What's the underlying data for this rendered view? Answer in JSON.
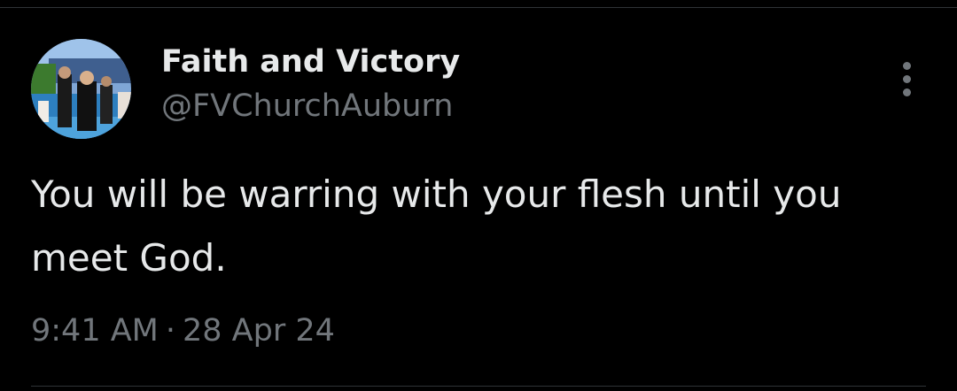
{
  "tweet": {
    "author": {
      "display_name": "Faith and Victory",
      "handle": "@FVChurchAuburn",
      "avatar_icon": "avatar-photo-baptism"
    },
    "more_icon": "more-vertical-icon",
    "text": "You will be warring with your flesh until you meet God.",
    "time": "9:41 AM",
    "separator": "·",
    "date": "28 Apr 24"
  },
  "colors": {
    "background": "#000000",
    "primary_text": "#e7e9ea",
    "secondary_text": "#71767b",
    "divider": "#2f3336"
  }
}
